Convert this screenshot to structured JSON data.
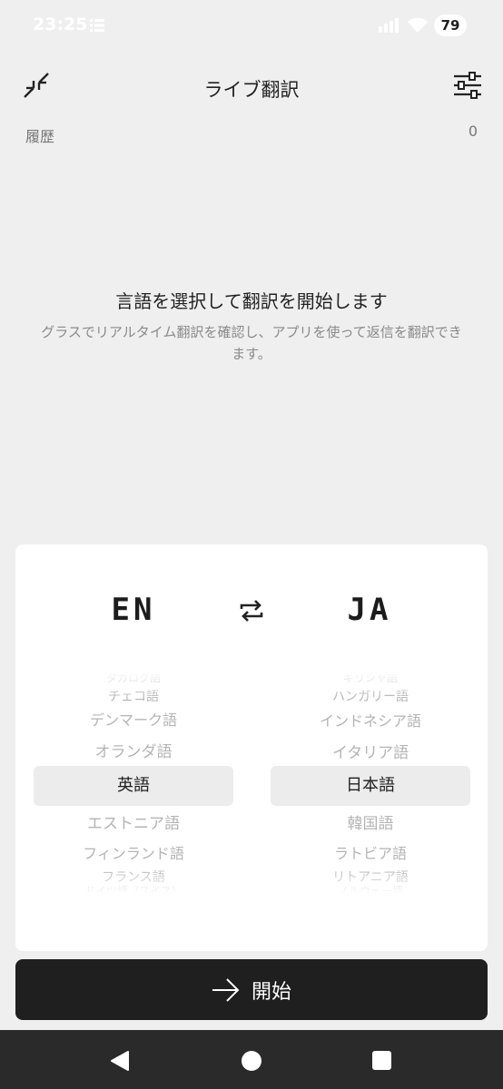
{
  "status": {
    "time": "23:25",
    "battery": "79"
  },
  "header": {
    "title": "ライブ翻訳"
  },
  "history": {
    "label": "履歴",
    "count": "0"
  },
  "empty_state": {
    "title": "言語を選択して翻訳を開始します",
    "description": "グラスでリアルタイム翻訳を確認し、アプリを使って返信を翻訳できます。"
  },
  "language_card": {
    "source_code": "EN",
    "target_code": "JA",
    "source_options": [
      "タガログ語",
      "チェコ語",
      "デンマーク語",
      "オランダ語",
      "英語",
      "エストニア語",
      "フィンランド語",
      "フランス語",
      "ドイツ語（スイス）"
    ],
    "source_selected": "英語",
    "target_options": [
      "ギリシャ語",
      "ハンガリー語",
      "インドネシア語",
      "イタリア語",
      "日本語",
      "韓国語",
      "ラトビア語",
      "リトアニア語",
      "ノルウェー語"
    ],
    "target_selected": "日本語"
  },
  "start_button": {
    "label": "開始"
  }
}
